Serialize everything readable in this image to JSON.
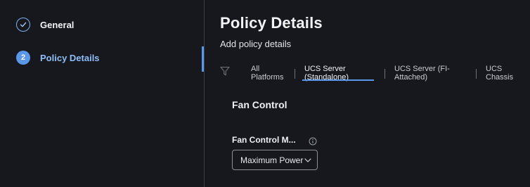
{
  "stepper": {
    "steps": [
      {
        "number": "",
        "label": "General",
        "state": "completed",
        "icon": "check-icon"
      },
      {
        "number": "2",
        "label": "Policy Details",
        "state": "active"
      }
    ]
  },
  "main": {
    "title": "Policy Details",
    "subtitle": "Add policy details",
    "filter": {
      "icon": "filter-icon",
      "tabs": [
        {
          "label": "All Platforms"
        },
        {
          "label": "UCS Server (Standalone)",
          "selected": true
        },
        {
          "label": "UCS Server (FI-Attached)"
        },
        {
          "label": "UCS Chassis"
        }
      ]
    },
    "section": {
      "title": "Fan Control",
      "field": {
        "label": "Fan Control M...",
        "info_icon": "info-icon",
        "value": "Maximum Power"
      }
    }
  },
  "colors": {
    "background": "#16181d",
    "accent": "#5b97e8",
    "active_step_label": "#8fbdf7"
  }
}
